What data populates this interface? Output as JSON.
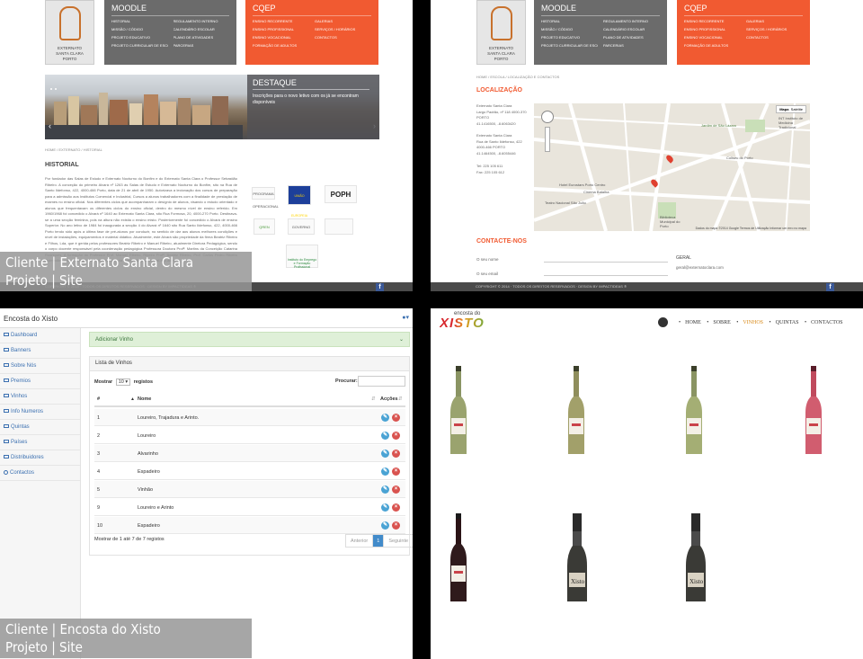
{
  "colors": {
    "moodle": "#6b6b6b",
    "qcep": "#f15a31",
    "accent": "#f15a31",
    "admin_link": "#3a6fb0"
  },
  "common": {
    "logo_text": [
      "EXTERNATO",
      "SANTA CLARA",
      "PORTO"
    ],
    "moodle_label": "MOODLE",
    "moodle_items": [
      "HISTORIAL",
      "REGULAMENTO INTERNO",
      "MISSÃO / CÓDIGO",
      "CALENDÁRIO ESCOLAR",
      "PROJETO EDUCATIVO",
      "PLANO DE ATIVIDADES",
      "PROJETO CURRICULAR DE ESCOLA",
      "PARCERIAS"
    ],
    "qcep_label": "CQEP",
    "qcep_items": [
      "ENSINO RECORRENTE",
      "GALERIAS",
      "ENSINO PROFISSIONAL",
      "SERVIÇOS / HORÁRIOS",
      "ENSINO VOCACIONAL",
      "CONTACTOS",
      "FORMAÇÃO DE ADULTOS",
      ""
    ],
    "footer": "COPYRIGHT © 2014 · TODOS OS DIREITOS RESERVADOS · DESIGN BY IMPACTIDEAS ®",
    "fb": "f"
  },
  "panel1": {
    "banner_title": "DESTAQUE",
    "banner_text": "Inscrições para o novo letivo com os já se encontram disponíveis",
    "breadcrumb": "HOME  /  EXTERNATO  /  HISTORIAL",
    "title": "HISTORIAL",
    "body": "Por fundador das Salas de Estudo e Externato Nocturno do Bonfim e do Externato Santa Clara o Professor Sebastião Ribeiro. A conceção do primeiro Alvará nº 1263 às Salas de Estudo e Externato Nocturno do Bonfim, sito na Rua de Santo Ildefonso, 422, 4000-466 Porto, data de 21 de abril de 1950. Autorizava a lecionação dos cursos de preparação para a admissão aos Institutos Comercial e Industrial, Cursos a alunos trabalhadores com a finalidade de prestação de exames no ensino oficial. Nos diferentes ciclos que acompanharam o desígnio de alunos, visando o estudo orientado e alunos que frequentavam os diferentes ciclos do ensino oficial, dentro do mesmo nível de ensino referido. Em 1960/1968 foi concedido o Alvará nº 1640 ao Externato Santa Clara, sito Rua Formosa, 20, 4000-270 Porto. Destinava-se a uma secção feminina, pois na altura não existia o ensino misto. Posteriormente foi concedido o Alvará de ensino Superior. No ano letivo de 1984 foi inaugurada a secção 4 do Alvará nº 1640 sito Rua Santo Ildefonso, 422, 4000-466 Porto tendo sido após a última fase de pré-alunos por conduzir, no sentido de dar aos alunos melhores condições e nível de instalações, equipamentos e material didático. Atualmente, este Alvará são propriedade da firma Beatriz Ribeiro e Filhos, Lda, que é gerida pelos professores Beatriz Ribeiro e Manuel Ribeiro, atualmente Diretora Pedagógica, sendo o corpo docente responsável pela coordenação pedagógica Professora Doutora Profª. Martins da Conceição Catarina Rodrigues. A formação do Professor Prof. Manuel Ribeiro, Ribeiro Profª. Beatriz Ribeiro, Prof. Carlos Pedro Ribeiro Guimarães com a Direção também presentes na orientação profissional dos alunos.",
    "partners": [
      "PROGRAMA OPERACIONAL",
      "UNIÃO EUROPEIA",
      "POPH",
      "QREN",
      "GOVERNO",
      "Instituto do Emprego e Formação Profissional",
      ""
    ]
  },
  "panel2": {
    "breadcrumb": "HOME  /  ESCOLA  /  LOCALIZAÇÃO E CONTACTOS",
    "title": "LOCALIZAÇÃO",
    "address1": [
      "Externato Santa Clara",
      "Largo Padrão, nº 118 4000-370 PORTO",
      "41.1416500, -8.6063420"
    ],
    "address2": [
      "Externato Santa Clara",
      "Rua de Santo Ildefonso, 422",
      "4000-466 PORTO",
      "41.1464500, -8.6055446"
    ],
    "phones": [
      "Tel: 225 105 611",
      "Fax: 225 105 612"
    ],
    "map_btns": [
      "Mapa",
      "Satélite"
    ],
    "map_labels": [
      "Jardim de São Lázaro",
      "INT Instituto de Medicina Tradicional",
      "Hotel Eurostars Porto Centro",
      "Cinema Batalha",
      "Biblioteca Municipal do Porto",
      "Teatro Nacional São João",
      "Coliseu do Porto"
    ],
    "map_footer": "Dados do mapa ©2014 Google   Termos de Utilização   Informar um erro no mapa",
    "contact_title": "CONTACTE-NOS",
    "field_name": "O seu nome",
    "field_email": "O seu email",
    "general": "GERAL",
    "general_email": "geral@externatoclara.com"
  },
  "panel3": {
    "app_title": "Encosta do Xisto",
    "user_icon": "user-icon",
    "sidebar": [
      "Dashboard",
      "Banners",
      "Sobre Nós",
      "Premios",
      "Vinhos",
      "Info Numeros",
      "Quintas",
      "Países",
      "Distribuidores",
      "Contactos"
    ],
    "add_label": "Adicionar Vinho",
    "list_title": "Lista de Vinhos",
    "show_label": "Mostrar",
    "show_value": "10",
    "records_label": "registos",
    "search_label": "Procurar:",
    "columns": [
      "#",
      "Nome",
      "Acções"
    ],
    "rows": [
      [
        "1",
        "Loureiro, Trajadura e Arinto."
      ],
      [
        "2",
        "Loureiro"
      ],
      [
        "3",
        "Alvarinho"
      ],
      [
        "4",
        "Espadeiro"
      ],
      [
        "5",
        "Vinhão"
      ],
      [
        "9",
        "Loureiro e Arinto"
      ],
      [
        "10",
        "Espadeiro"
      ]
    ],
    "info": "Mostrar de 1 até 7 de 7 registos",
    "prev": "Anterior",
    "page": "1",
    "next": "Seguinte"
  },
  "panel4": {
    "logo_small": "encosta do",
    "logo_big": "XISTO",
    "menu": [
      "HOME",
      "SOBRE",
      "VINHOS",
      "QUINTAS",
      "CONTACTOS"
    ],
    "active_menu": "VINHOS"
  },
  "captions": {
    "c1_line1": "Cliente | Externato Santa Clara",
    "c1_line2": "Projeto | Site",
    "c2_line1": "Cliente | Encosta do Xisto",
    "c2_line2": "Projeto | Site"
  }
}
